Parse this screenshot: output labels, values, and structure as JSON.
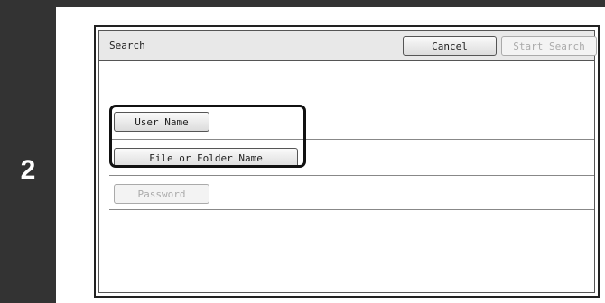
{
  "step": {
    "number": "2"
  },
  "panel": {
    "title": "Search",
    "cancel_label": "Cancel",
    "start_search_label": "Start Search"
  },
  "fields": {
    "user_name_label": "User Name",
    "file_or_folder_label": "File or Folder Name",
    "password_label": "Password"
  },
  "colors": {
    "side_bar": "#333333",
    "header_bg": "#e8e8e8",
    "disabled_text": "#aaaaaa"
  }
}
